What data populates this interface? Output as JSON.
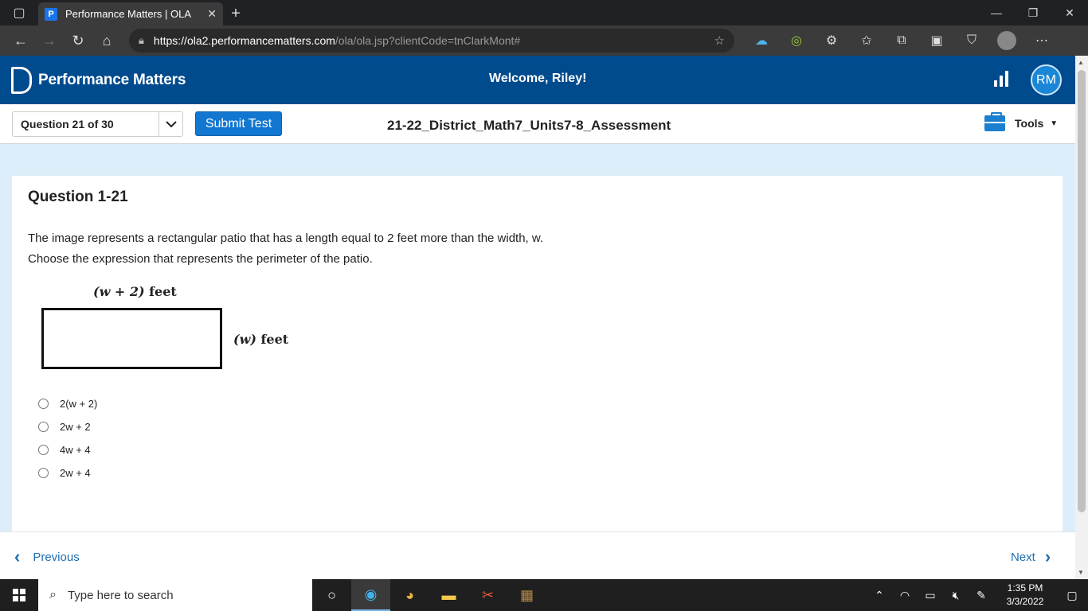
{
  "browser": {
    "tab_title": "Performance Matters | OLA",
    "tab_favicon": "P",
    "url_host": "https://ola2.performancematters.com",
    "url_path": "/ola/ola.jsp?clientCode=tnClarkMont#"
  },
  "header": {
    "brand": "Performance Matters",
    "welcome": "Welcome, Riley!",
    "avatar_initials": "RM"
  },
  "testbar": {
    "question_selector": "Question 21 of 30",
    "submit_label": "Submit Test",
    "test_title": "21-22_District_Math7_Units7-8_Assessment",
    "tools_label": "Tools"
  },
  "question": {
    "title": "Question 1-21",
    "prompt_line1": "The image represents a rectangular patio that has a length equal to 2 feet more than the width, w.",
    "prompt_line2": "Choose the expression that represents the perimeter of the patio.",
    "figure": {
      "top_label_var": "(w + 2)",
      "top_label_unit": "feet",
      "side_label_var": "(w)",
      "side_label_unit": "feet"
    },
    "choices": [
      {
        "label": "2(w + 2)"
      },
      {
        "label": "2w + 2"
      },
      {
        "label": "4w + 4"
      },
      {
        "label": "2w + 4"
      }
    ]
  },
  "footer": {
    "previous_label": "Previous",
    "next_label": "Next"
  },
  "taskbar": {
    "search_placeholder": "Type here to search",
    "time": "1:35 PM",
    "date": "3/3/2022"
  },
  "colors": {
    "header_bg": "#004b8d",
    "submit_bg": "#1277d0",
    "page_bg": "#ddeefa",
    "link": "#1f6fb3"
  }
}
